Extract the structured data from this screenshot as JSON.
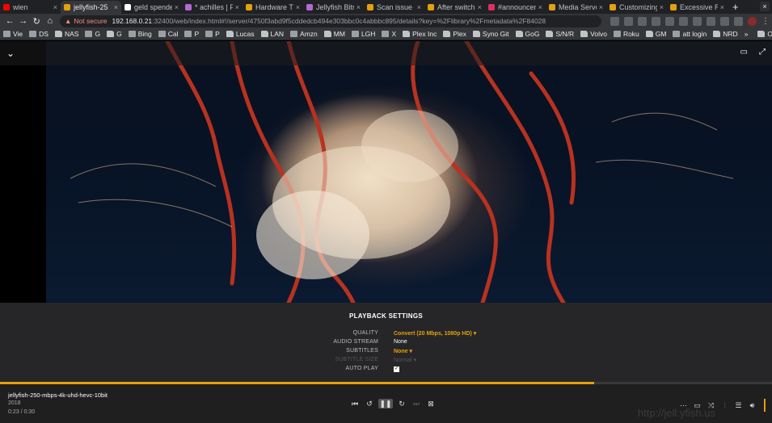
{
  "browser": {
    "tabs": [
      {
        "title": "wien",
        "fav": "#ff0000"
      },
      {
        "title": "jellyfish-25",
        "fav": "#e5a00d",
        "active": true
      },
      {
        "title": "geld spende",
        "fav": "#ffffff"
      },
      {
        "title": "* achilles | P",
        "fav": "#b06ad6"
      },
      {
        "title": "Hardware Tr",
        "fav": "#e5a00d"
      },
      {
        "title": "Jellyfish Bitra",
        "fav": "#b06ad6"
      },
      {
        "title": "Scan issue o",
        "fav": "#e5a00d"
      },
      {
        "title": "After switch",
        "fav": "#e5a00d"
      },
      {
        "title": "#announcem",
        "fav": "#e03060"
      },
      {
        "title": "Media Serve",
        "fav": "#e5a00d"
      },
      {
        "title": "Customizing",
        "fav": "#e5a00d"
      },
      {
        "title": "Excessive RA",
        "fav": "#e5a00d"
      }
    ],
    "new_tab": "+",
    "close_window": "×",
    "not_secure": "Not secure",
    "url_host": "192.168.0.21",
    "url_rest": ":32400/web/index.html#!/server/4750f3abd9f5cddedcb494e303bbc0c4abbbc895/details?key=%2Flibrary%2Fmetadata%2F84028",
    "bookmarks": [
      {
        "label": "Vie",
        "folder": false
      },
      {
        "label": "DS",
        "folder": false
      },
      {
        "label": "NAS",
        "folder": true
      },
      {
        "label": "G",
        "folder": false
      },
      {
        "label": "G",
        "folder": true
      },
      {
        "label": "Bing",
        "folder": false
      },
      {
        "label": "Cal",
        "folder": false
      },
      {
        "label": "P",
        "folder": false
      },
      {
        "label": "P",
        "folder": false
      },
      {
        "label": "Lucas",
        "folder": true
      },
      {
        "label": "LAN",
        "folder": true
      },
      {
        "label": "Amzn",
        "folder": false
      },
      {
        "label": "MM",
        "folder": true
      },
      {
        "label": "LGH",
        "folder": false
      },
      {
        "label": "X",
        "folder": false
      },
      {
        "label": "Plex Inc",
        "folder": true
      },
      {
        "label": "Plex",
        "folder": true
      },
      {
        "label": "Syno Git",
        "folder": true
      },
      {
        "label": "GoG",
        "folder": true
      },
      {
        "label": "S/N/R",
        "folder": true
      },
      {
        "label": "Volvo",
        "folder": true
      },
      {
        "label": "Roku",
        "folder": false
      },
      {
        "label": "GM",
        "folder": true
      },
      {
        "label": "att login",
        "folder": false
      },
      {
        "label": "NRD",
        "folder": true
      }
    ],
    "bookmarks_more": "»",
    "other_bookmarks": "Other bookmarks"
  },
  "player": {
    "settings": {
      "heading": "PLAYBACK SETTINGS",
      "rows": [
        {
          "label": "QUALITY",
          "value": "Convert (20 Mbps, 1080p HD) ▾",
          "accent": true
        },
        {
          "label": "AUDIO STREAM",
          "value": "None"
        },
        {
          "label": "SUBTITLES",
          "value": "None ▾",
          "accent": true
        },
        {
          "label": "SUBTITLE SIZE",
          "value": "Normal ▾",
          "dim": true
        },
        {
          "label": "AUTO PLAY",
          "value": "",
          "checkbox": true
        }
      ]
    },
    "progress": 0.77,
    "media": {
      "title": "jellyfish-250-mbps-4k-uhd-hevc-10bit",
      "year": "2018",
      "time": "0:23 / 0:30"
    },
    "watermark": "http://jell.yfish.us"
  },
  "colors": {
    "accent": "#e5a00d"
  }
}
